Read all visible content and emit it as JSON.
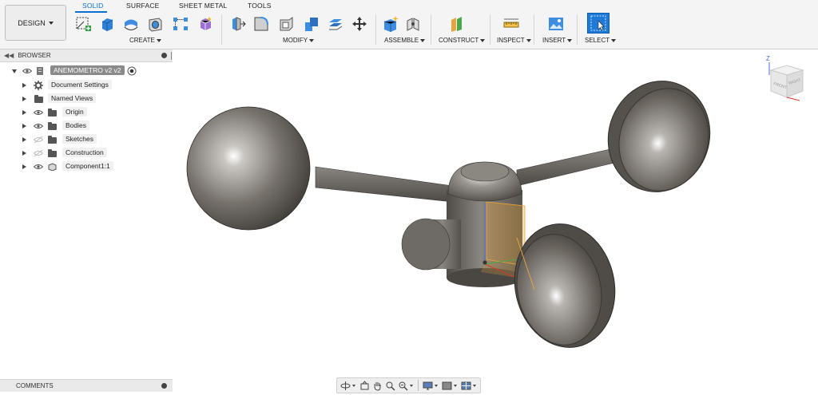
{
  "toolbar": {
    "workspace": "DESIGN",
    "tabs": [
      "SOLID",
      "SURFACE",
      "SHEET METAL",
      "TOOLS"
    ],
    "groups": {
      "create": "CREATE",
      "modify": "MODIFY",
      "assemble": "ASSEMBLE",
      "construct": "CONSTRUCT",
      "inspect": "INSPECT",
      "insert": "INSERT",
      "select": "SELECT"
    }
  },
  "browser": {
    "title": "BROWSER",
    "root": "ANEMOMETRO v2 v2",
    "items": [
      {
        "label": "Document Settings",
        "icon": "gear-icon"
      },
      {
        "label": "Named Views",
        "icon": "folder-icon"
      },
      {
        "label": "Origin",
        "icon": "folder-icon"
      },
      {
        "label": "Bodies",
        "icon": "folder-icon"
      },
      {
        "label": "Sketches",
        "icon": "folder-icon"
      },
      {
        "label": "Construction",
        "icon": "folder-icon"
      },
      {
        "label": "Component1:1",
        "icon": "component-icon"
      }
    ]
  },
  "comments": {
    "title": "COMMENTS"
  },
  "viewcube": {
    "front": "FRONT",
    "right": "RIGHT",
    "axis_z": "Z"
  },
  "colors": {
    "accent": "#0a6fd1",
    "model": "#6b6762",
    "highlight": "#e8a33a"
  }
}
